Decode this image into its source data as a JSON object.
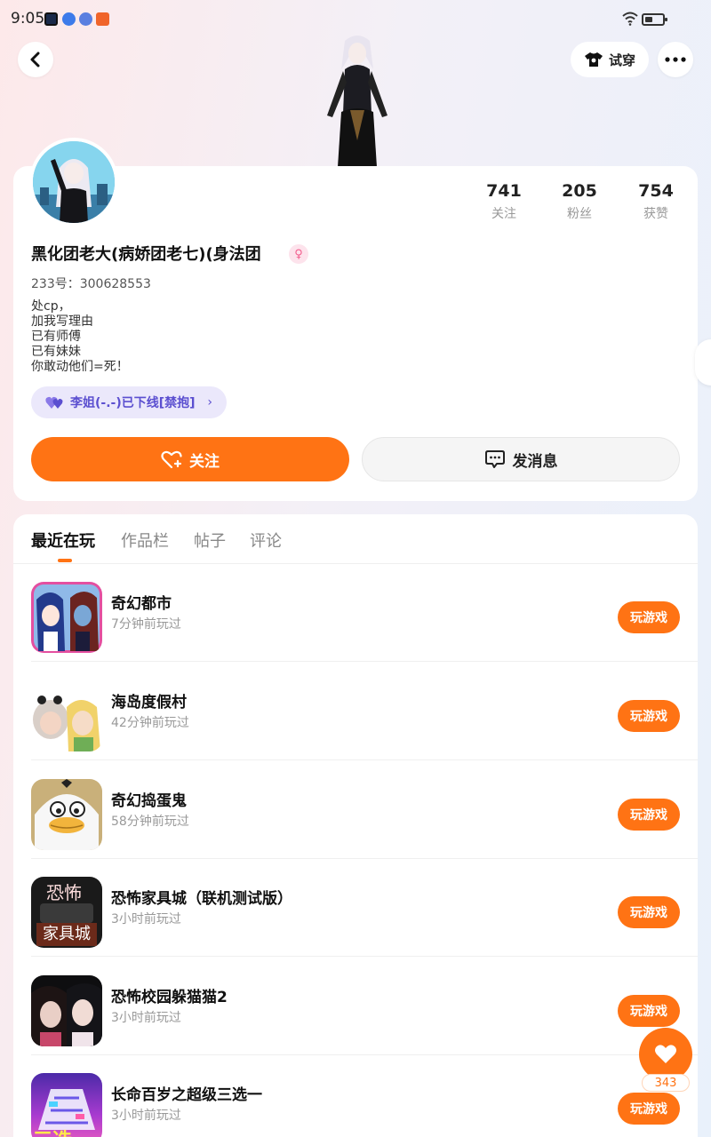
{
  "status_bar": {
    "time": "9:05"
  },
  "header": {
    "try_on_label": "试穿"
  },
  "profile": {
    "stats": [
      {
        "value": "741",
        "label": "关注"
      },
      {
        "value": "205",
        "label": "粉丝"
      },
      {
        "value": "754",
        "label": "获赞"
      }
    ],
    "nickname": "黑化团老大(病娇团老七)(身法团",
    "gender_symbol": "♀",
    "user_id": "233号：300628553",
    "bio_lines": [
      "处cp，",
      "加我写理由",
      "已有师傅",
      "已有妹妹",
      "你敢动他们=死！"
    ],
    "cp_tag": "李姐(-.-)已下线[禁抱]",
    "follow_label": "关注",
    "message_label": "发消息"
  },
  "tabs": [
    {
      "label": "最近在玩",
      "active": true
    },
    {
      "label": "作品栏",
      "active": false
    },
    {
      "label": "帖子",
      "active": false
    },
    {
      "label": "评论",
      "active": false
    }
  ],
  "games": [
    {
      "name": "奇幻都市",
      "time": "7分钟前玩过",
      "button": "玩游戏",
      "icon": "anime-duo-game-icon"
    },
    {
      "name": "海岛度假村",
      "time": "42分钟前玩过",
      "button": "玩游戏",
      "icon": "island-characters-game-icon"
    },
    {
      "name": "奇幻捣蛋鬼",
      "time": "58分钟前玩过",
      "button": "玩游戏",
      "icon": "white-duck-game-icon"
    },
    {
      "name": "恐怖家具城（联机测试版）",
      "time": "3小时前玩过",
      "button": "玩游戏",
      "icon": "horror-furniture-game-icon",
      "icon_text_top": "恐怖",
      "icon_text_bottom": "家具城"
    },
    {
      "name": "恐怖校园躲猫猫2",
      "time": "3小时前玩过",
      "button": "玩游戏",
      "icon": "horror-school-game-icon"
    },
    {
      "name": "长命百岁之超级三选一",
      "time": "3小时前玩过",
      "button": "玩游戏",
      "icon": "choose-one-game-icon",
      "icon_text": "三选一"
    }
  ],
  "like_count": "343",
  "colors": {
    "accent": "#ff7314",
    "cp_tag_bg": "#ebe8fb",
    "cp_tag_text": "#5b4fd0"
  }
}
